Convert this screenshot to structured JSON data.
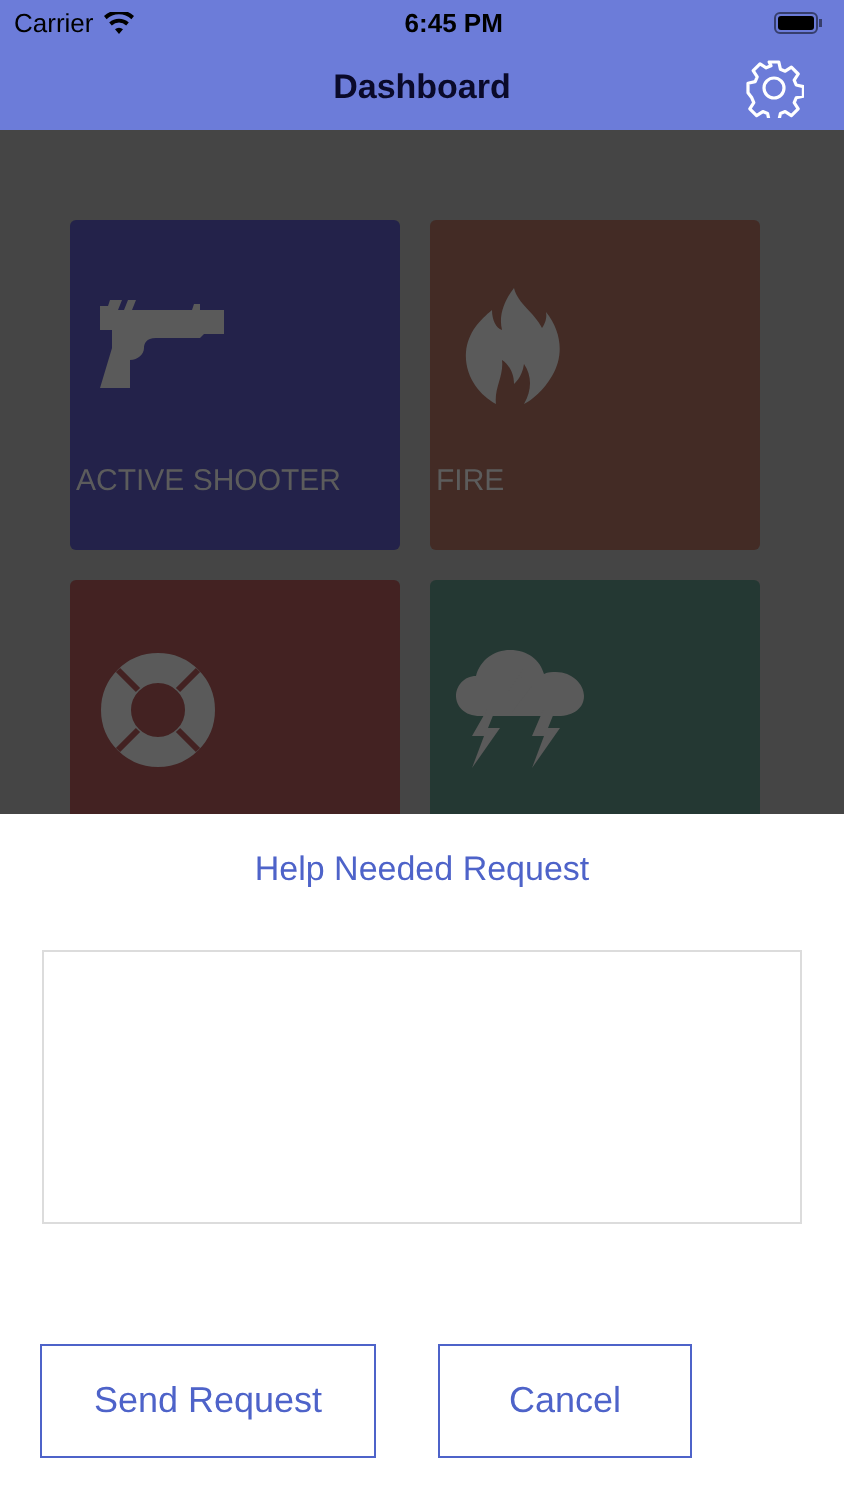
{
  "status_bar": {
    "carrier": "Carrier",
    "time": "6:45 PM"
  },
  "nav": {
    "title": "Dashboard"
  },
  "tiles": [
    {
      "kind": "gun",
      "label": "ACTIVE SHOOTER",
      "color": "#23224a"
    },
    {
      "kind": "fire",
      "label": "FIRE",
      "color": "#432b25"
    },
    {
      "kind": "lifebuoy",
      "color": "#432222"
    },
    {
      "kind": "storm",
      "color": "#243833"
    }
  ],
  "sheet": {
    "title": "Help Needed Request",
    "buttons": [
      {
        "label": "Send Request"
      },
      {
        "label": "Cancel"
      }
    ]
  }
}
